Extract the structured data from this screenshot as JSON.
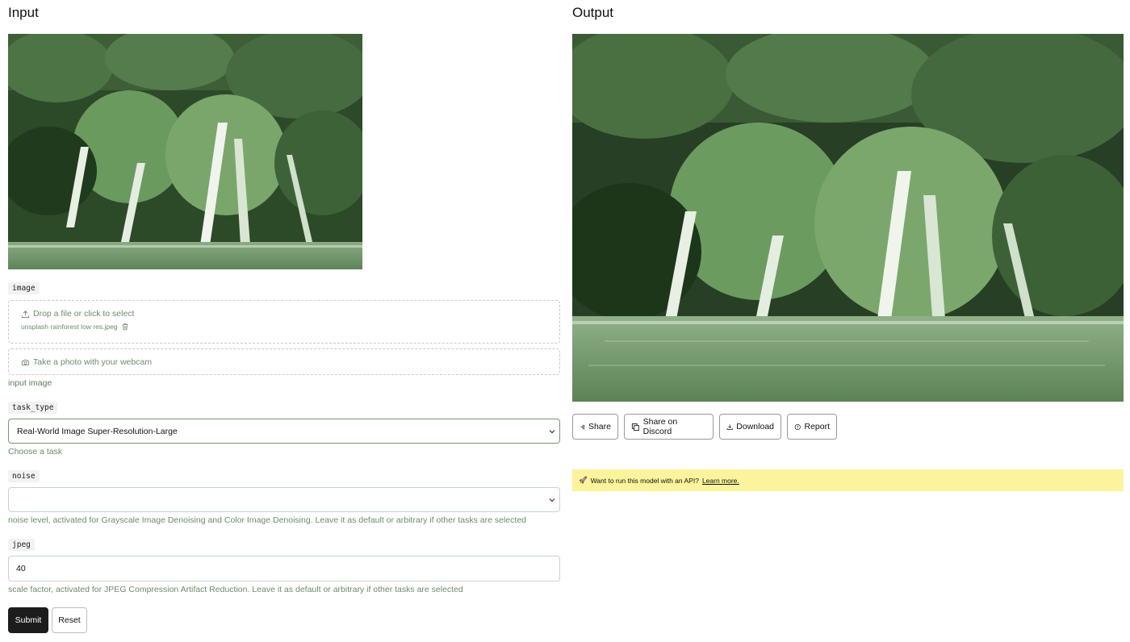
{
  "input": {
    "title": "Input",
    "image_field": {
      "label": "image",
      "drop_text": "Drop a file or click to select",
      "file_name": "unsplash rainforest low res.jpeg",
      "webcam_text": "Take a photo with your webcam",
      "help": "input image"
    },
    "task_type": {
      "label": "task_type",
      "value": "Real-World Image Super-Resolution-Large",
      "help": "Choose a task"
    },
    "noise": {
      "label": "noise",
      "value": "",
      "help": "noise level, activated for Grayscale Image Denoising and Color Image Denoising. Leave it as default or arbitrary if other tasks are selected"
    },
    "jpeg": {
      "label": "jpeg",
      "value": "40",
      "help": "scale factor, activated for JPEG Compression Artifact Reduction. Leave it as default or arbitrary if other tasks are selected"
    },
    "buttons": {
      "submit": "Submit",
      "reset": "Reset"
    }
  },
  "output": {
    "title": "Output",
    "buttons": {
      "share": "Share",
      "share_discord": "Share on Discord",
      "download": "Download",
      "report": "Report"
    },
    "banner": {
      "emoji": "🚀",
      "text": "Want to run this model with an API?",
      "link": "Learn more."
    }
  },
  "colors": {
    "help_text": "#6b8c6b",
    "banner_bg": "#fbf49c",
    "submit_bg": "#1c1c1c",
    "image_tint": "#5f8a5a"
  },
  "icons": [
    "upload-icon",
    "trash-icon",
    "camera-icon",
    "chevron-down-icon",
    "share-icon",
    "copy-icon",
    "download-icon",
    "alert-circle-icon",
    "rocket-icon"
  ]
}
